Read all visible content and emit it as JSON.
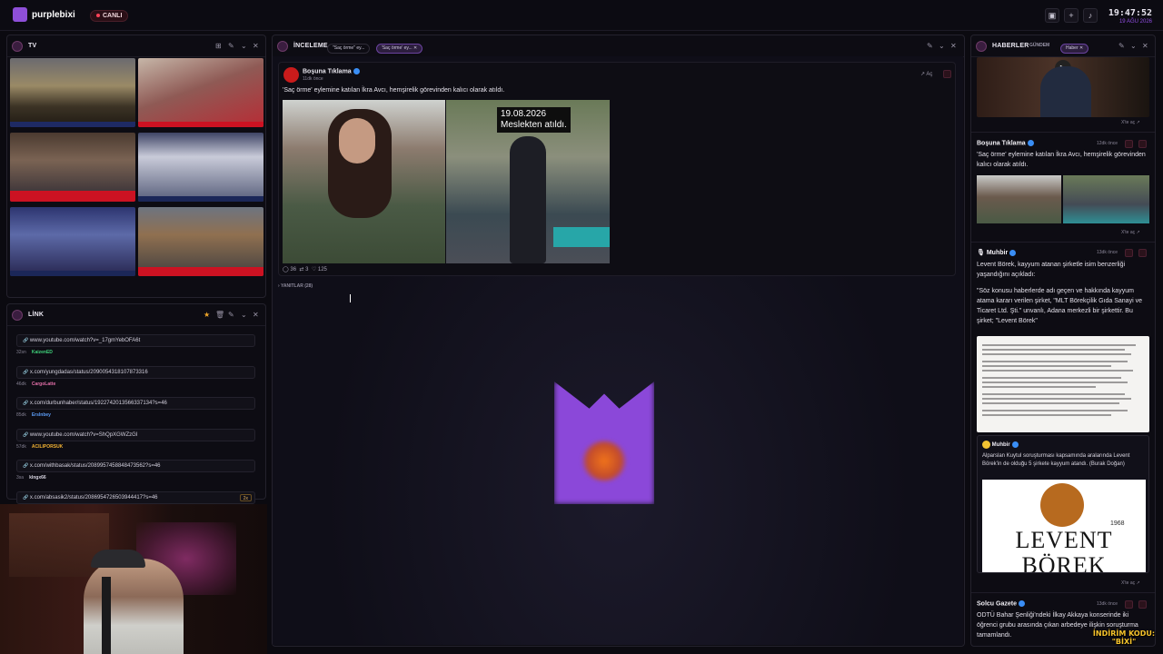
{
  "app": {
    "brand": "purplebixi",
    "live_label": "CANLI"
  },
  "clock": {
    "time": "19:47:52",
    "date": "19 AĞU 2026"
  },
  "top_icons": [
    "image-icon",
    "plus-icon",
    "volume-icon"
  ],
  "tv_panel": {
    "title": "TV"
  },
  "link_panel": {
    "title": "LİNK",
    "links": [
      {
        "url": "www.youtube.com/watch?v=_17gmYebOFA6t",
        "time": "32sn",
        "user": "KaizenED",
        "user_color": "#3fd07a"
      },
      {
        "url": "x.com/yungdadas/status/2090054318107873316",
        "time": "46dk",
        "user": "CargoLatte",
        "user_color": "#e26fa8"
      },
      {
        "url": "x.com/durbunhaber/status/1922742013566337134?s=46",
        "time": "85dk",
        "user": "Erslnbey",
        "user_color": "#5b9cf5"
      },
      {
        "url": "www.youtube.com/watch?v=ShQpXGWZzGI",
        "time": "57dk",
        "user": "ACILIPORSUK",
        "user_color": "#f2b233"
      },
      {
        "url": "x.com/withbasak/status/2089957458848473562?s=46",
        "time": "3sa",
        "user": "klngx66",
        "user_color": "#d8d5e2"
      },
      {
        "url": "x.com/absasik2/status/2086954726503944417?s=46",
        "time": "",
        "user": "",
        "user_color": "#d8d5e2",
        "badge": "2x"
      }
    ]
  },
  "inceleme": {
    "title": "İNCELEME",
    "tabs": [
      {
        "label": "\"Saç örme\" ey..."
      },
      {
        "label": "'Saç örme' ey..."
      }
    ],
    "post": {
      "author": "Boşuna Tıklama",
      "time": "11dk önce",
      "open_label": "Aç",
      "text": "'Saç örme' eylemine katılan İkra Avcı, hemşirelik görevinden kalıcı olarak atıldı.",
      "overlay_date": "19.08.2026",
      "overlay_text": "Meslekten atıldı.",
      "comments": "36",
      "reposts": "3",
      "likes": "125"
    },
    "replies_label": "YANITLAR (28)"
  },
  "news_panel": {
    "title": "HABERLER",
    "tabs": [
      {
        "label": "GÜNDEM"
      },
      {
        "label": "Haber"
      }
    ],
    "open_label": "X'te aç",
    "items": [
      {
        "source": "Boşuna Tıklama",
        "time": "12dk önce",
        "text": "'Saç örme' eylemine katılan İkra Avcı, hemşirelik görevinden kalıcı olarak atıldı."
      },
      {
        "source": "Muhbir",
        "time": "13dk önce",
        "text": "Levent Börek, kayyum atanan şirketle isim benzerliği yaşandığını açıkladı:",
        "quote": "\"Söz konusu haberlerde adı geçen ve hakkında kayyum atama kararı verilen şirket, \"MLT Börekçilik Gıda Sanayi ve Ticaret Ltd. Şti.\" unvanlı, Adana merkezli bir şirkettir. Bu şirket; \"Levent Börek\"",
        "quoted_source": "Muhbir",
        "quoted_text": "Alparslan Kuytul soruşturması kapsamında aralarında Levent Börek'in de olduğu 5 şirkete kayyum atandı. (Burak Doğan)",
        "logo_year": "1968",
        "logo_text_1": "LEVENT",
        "logo_text_2": "BÖREK"
      },
      {
        "source": "Solcu Gazete",
        "time": "13dk önce",
        "text": "ODTÜ Bahar Şenliği'ndeki İlkay Akkaya konserinde iki öğrenci grubu arasında çıkan arbedeye ilişkin soruşturma tamamlandı."
      }
    ]
  },
  "promo": {
    "line1": "İNDİRİM KODU:",
    "line2": "\"BİXİ\""
  },
  "colors": {
    "accent": "#8e4fd8",
    "live": "#ff4258",
    "verified": "#3a8ef5"
  }
}
